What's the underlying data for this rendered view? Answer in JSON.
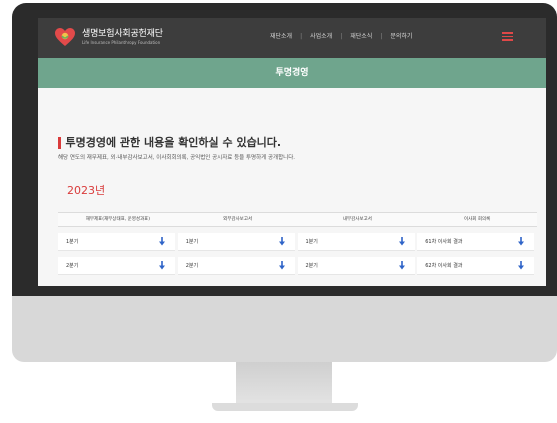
{
  "header": {
    "logo_name": "생명보험사회공헌재단",
    "logo_sub": "Life Insurance Philanthropy Foundation",
    "nav": [
      "재단소개",
      "사업소개",
      "재단소식",
      "문의하기"
    ]
  },
  "banner": {
    "title": "투명경영"
  },
  "intro": {
    "heading": "투명경영에 관한 내용을 확인하실 수 있습니다.",
    "description": "해당 연도의 재무제표, 외·내부감사보고서, 이사회회의록, 공익법인 공시자료 등을 투명하게 공개합니다."
  },
  "year": "2023년",
  "table": {
    "columns": [
      "재무제표(재무상태표, 운영성과표)",
      "외부감사보고서",
      "내부감사보고서",
      "이사회 회의록"
    ],
    "rows": [
      [
        "1분기",
        "1분기",
        "1분기",
        "61차 이사회 결과"
      ],
      [
        "2분기",
        "2분기",
        "2분기",
        "62차 이사회 결과"
      ]
    ]
  },
  "colors": {
    "accent_red": "#d93b3b",
    "banner_green": "#6fa58d",
    "topbar": "#3d3d3d",
    "download_blue": "#2f64c8"
  }
}
